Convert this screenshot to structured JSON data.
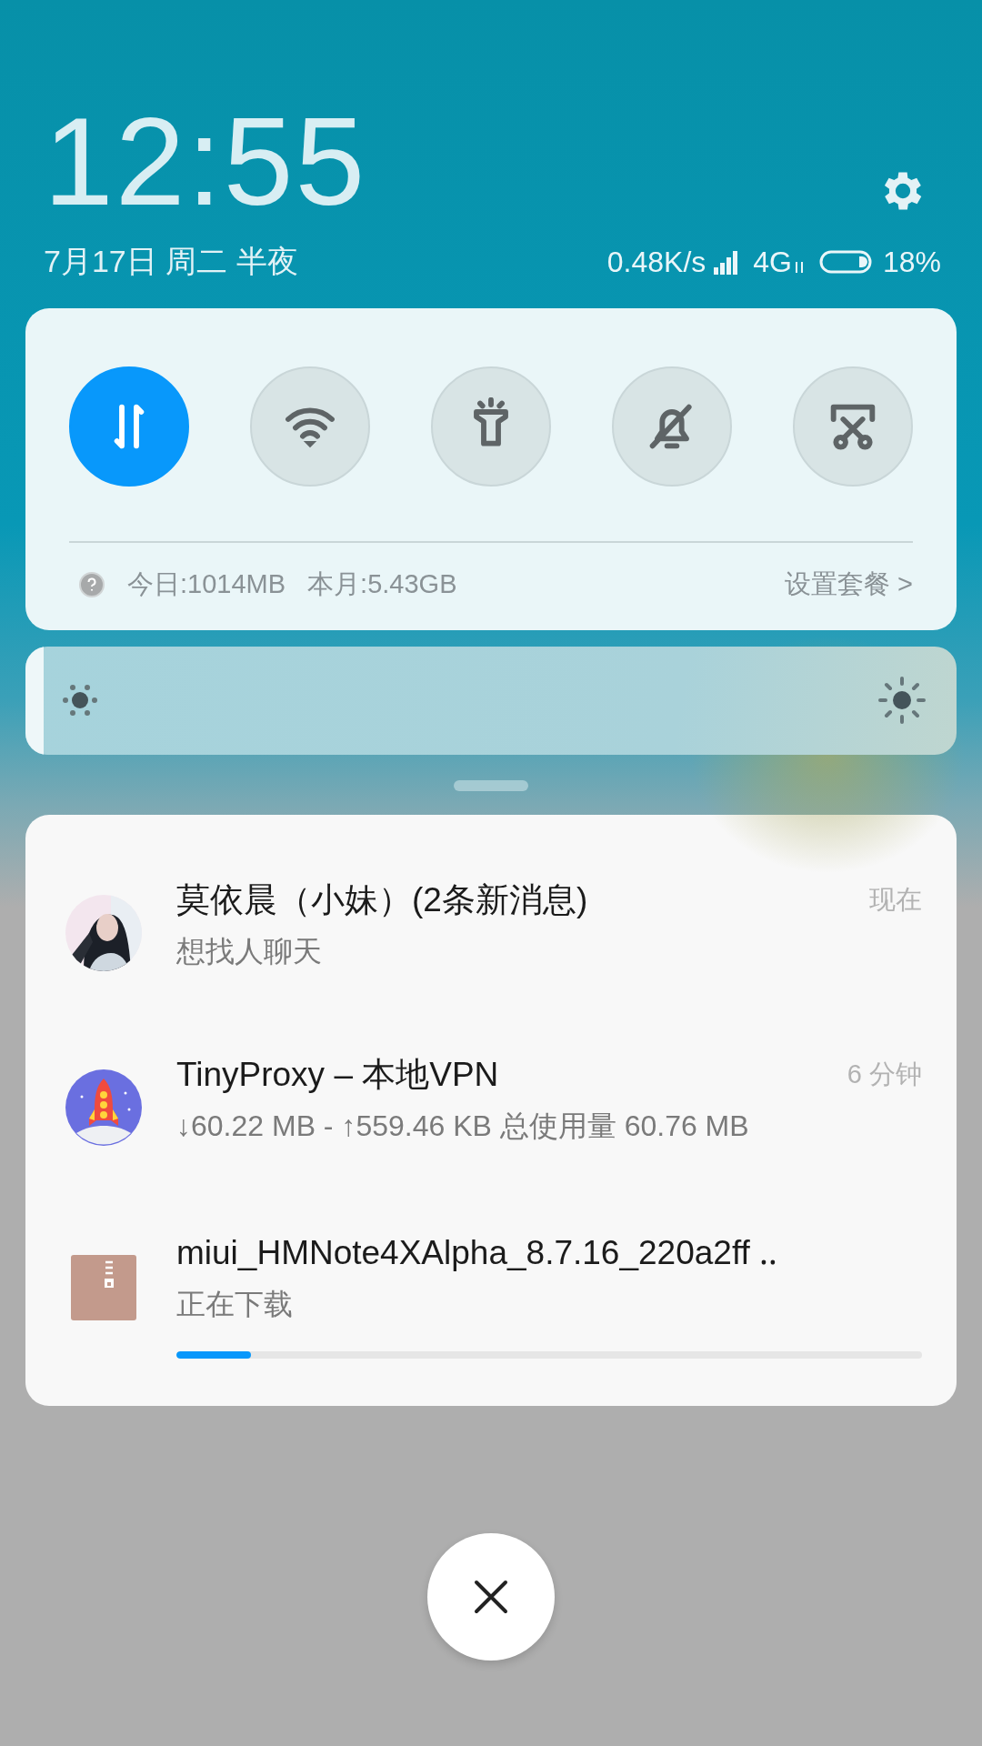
{
  "clock": {
    "time": "12:55",
    "date": "7月17日 周二 半夜"
  },
  "status_bar": {
    "speed": "0.48K/s",
    "network": "4G",
    "battery": "18%"
  },
  "quick_settings": {
    "toggles": [
      {
        "kind": "data",
        "on": true
      },
      {
        "kind": "wifi",
        "on": false
      },
      {
        "kind": "flashlight",
        "on": false
      },
      {
        "kind": "silent",
        "on": false
      },
      {
        "kind": "screenshot",
        "on": false
      }
    ],
    "data_usage": {
      "today": "今日:1014MB",
      "month": "本月:5.43GB",
      "plan_link": "设置套餐 >"
    }
  },
  "brightness": {
    "level": 0.02
  },
  "notifications": [
    {
      "kind": "message",
      "title": "莫依晨（小妹）(2条新消息)",
      "text": "想找人聊天",
      "time": "现在"
    },
    {
      "kind": "vpn",
      "title": "TinyProxy  –  本地VPN",
      "text": "↓60.22 MB - ↑559.46 KB 总使用量 60.76 MB",
      "time": "6  分钟"
    },
    {
      "kind": "download",
      "title": "miui_HMNote4XAlpha_8.7.16_220a2ff ‥",
      "text": "正在下载",
      "level": 0.1
    }
  ]
}
